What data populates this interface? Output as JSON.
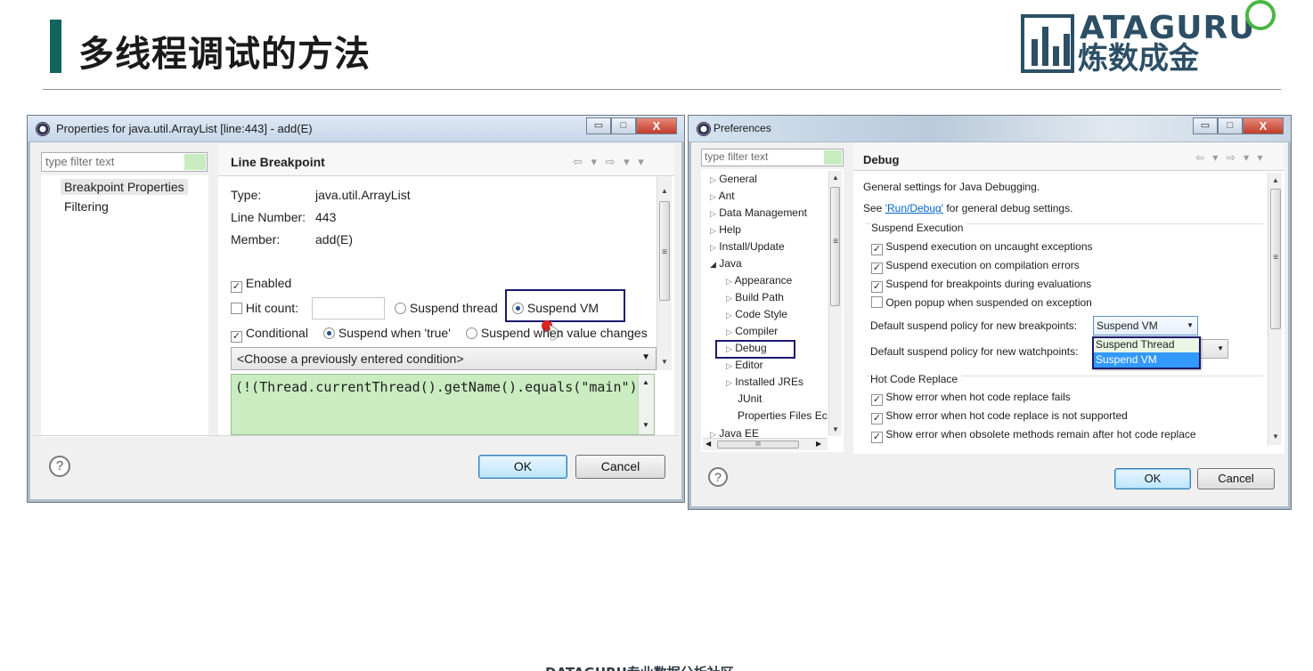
{
  "slide": {
    "title": "多线程调试的方法",
    "logo_top": "ATAGURU",
    "logo_bottom": "炼数成金",
    "footer": "DATAGURU专业数据分析社区"
  },
  "left_dialog": {
    "window_title": "Properties for java.util.ArrayList [line:443] - add(E)",
    "controls": {
      "minimize": "▭",
      "maximize": "□",
      "close": "X"
    },
    "filter_placeholder": "type filter text",
    "tree_items": [
      "Breakpoint Properties",
      "Filtering"
    ],
    "section_title": "Line Breakpoint",
    "nav_arrows": "⇦ ▾ ⇨ ▾ ▾",
    "info": [
      {
        "label": "Type:",
        "value": "java.util.ArrayList"
      },
      {
        "label": "Line Number:",
        "value": "443"
      },
      {
        "label": "Member:",
        "value": "add(E)"
      }
    ],
    "enabled_label": "Enabled",
    "hit_count_label": "Hit count:",
    "hit_count_value": "",
    "suspend_thread_label": "Suspend thread",
    "suspend_vm_label": "Suspend VM",
    "conditional_label": "Conditional",
    "suspend_true_label": "Suspend when 'true'",
    "suspend_changes_label": "Suspend when value changes",
    "condition_select": "<Choose a previously entered condition>",
    "condition_code": "(!(Thread.currentThread().getName().equals(\"main\")",
    "ok": "OK",
    "cancel": "Cancel",
    "help": "?"
  },
  "right_dialog": {
    "window_title": "Preferences",
    "controls": {
      "minimize": "▭",
      "maximize": "□",
      "close": "X"
    },
    "filter_placeholder": "type filter text",
    "tree": [
      {
        "label": "General",
        "arrow": "▷"
      },
      {
        "label": "Ant",
        "arrow": "▷"
      },
      {
        "label": "Data Management",
        "arrow": "▷"
      },
      {
        "label": "Help",
        "arrow": "▷"
      },
      {
        "label": "Install/Update",
        "arrow": "▷"
      },
      {
        "label": "Java",
        "arrow": "◢"
      },
      {
        "label": "Appearance",
        "arrow": "▷"
      },
      {
        "label": "Build Path",
        "arrow": "▷"
      },
      {
        "label": "Code Style",
        "arrow": "▷"
      },
      {
        "label": "Compiler",
        "arrow": "▷"
      },
      {
        "label": "Debug",
        "arrow": "▷"
      },
      {
        "label": "Editor",
        "arrow": "▷"
      },
      {
        "label": "Installed JREs",
        "arrow": "▷"
      },
      {
        "label": "JUnit",
        "arrow": ""
      },
      {
        "label": "Properties Files Ec",
        "arrow": ""
      },
      {
        "label": "Java EE",
        "arrow": "▷"
      }
    ],
    "hscroll_label": "III",
    "section_title": "Debug",
    "nav_arrows": "⇦ ▾ ⇨ ▾ ▾",
    "intro": "General settings for Java Debugging.",
    "see_prefix": "See ",
    "see_link": "'Run/Debug'",
    "see_suffix": " for general debug settings.",
    "suspend_group": "Suspend Execution",
    "suspend_options": [
      "Suspend execution on uncaught exceptions",
      "Suspend execution on compilation errors",
      "Suspend for breakpoints during evaluations",
      "Open popup when suspended on exception"
    ],
    "policy_breakpoints_label": "Default suspend policy for new breakpoints:",
    "policy_breakpoints_value": "Suspend VM",
    "policy_watchpoints_label": "Default suspend policy for new watchpoints:",
    "dropdown_options": [
      "Suspend Thread",
      "Suspend VM"
    ],
    "hcr_group": "Hot Code Replace",
    "hcr_options": [
      "Show error when hot code replace fails",
      "Show error when hot code replace is not supported",
      "Show error when obsolete methods remain after hot code replace"
    ],
    "ok": "OK",
    "cancel": "Cancel",
    "help": "?"
  },
  "colors": {
    "accent": "#13635f",
    "highlight": "#3399ff",
    "link": "#0066cc",
    "annotation_box": "#1a1a6e",
    "cursor_dot": "#e02424"
  }
}
